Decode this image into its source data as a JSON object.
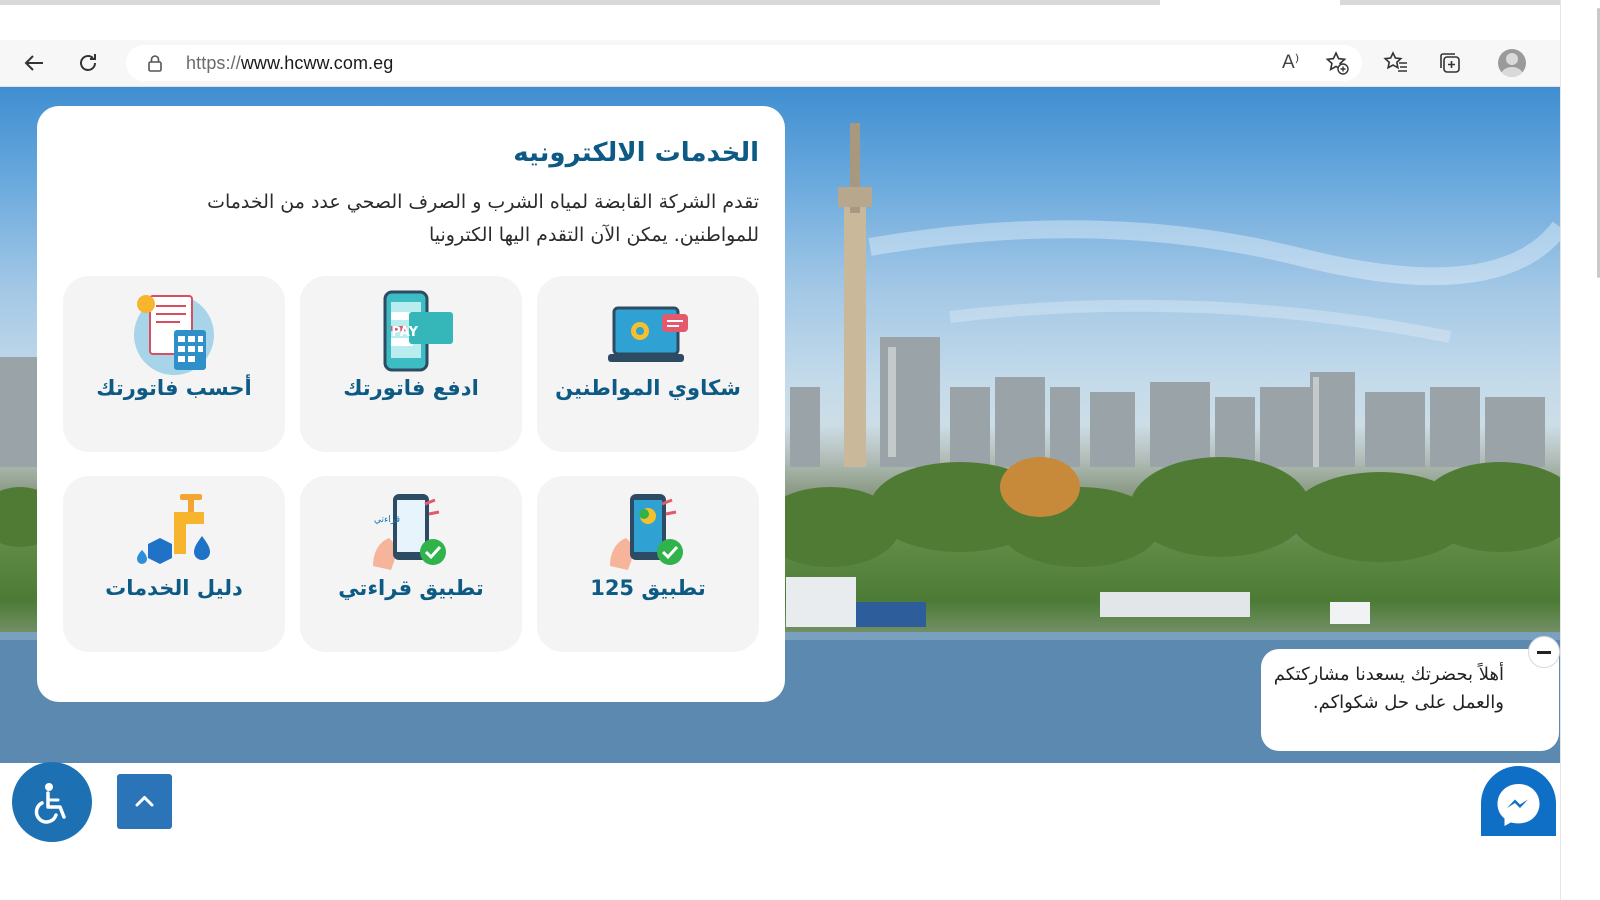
{
  "browser": {
    "url_scheme": "https://",
    "url_host": "www.hcww.com.eg",
    "read_aloud_label": "A⁾"
  },
  "services": {
    "title": "الخدمات الالكترونيه",
    "description": "تقدم الشركة القابضة لمياه الشرب و الصرف الصحي عدد من الخدمات للمواطنين. يمكن الآن التقدم اليها الكترونيا",
    "tiles": [
      {
        "label": "أحسب فاتورتك",
        "icon": "calculator-bill-icon"
      },
      {
        "label": "ادفع فاتورتك",
        "icon": "phone-pay-card-icon"
      },
      {
        "label": "شكاوي المواطنين",
        "icon": "laptop-complaint-icon"
      },
      {
        "label": "دليل الخدمات",
        "icon": "water-tap-icon"
      },
      {
        "label": "تطبيق قراءتي",
        "icon": "phone-app-check-icon"
      },
      {
        "label": "تطبيق 125",
        "icon": "phone-app-check-icon"
      }
    ]
  },
  "chat": {
    "message": "أهلاً بحضرتك يسعدنا مشاركتكم والعمل على حل شكواكم."
  },
  "colors": {
    "brand": "#0d5a85",
    "accent": "#1d71b3",
    "tile_bg": "#f4f4f4"
  }
}
